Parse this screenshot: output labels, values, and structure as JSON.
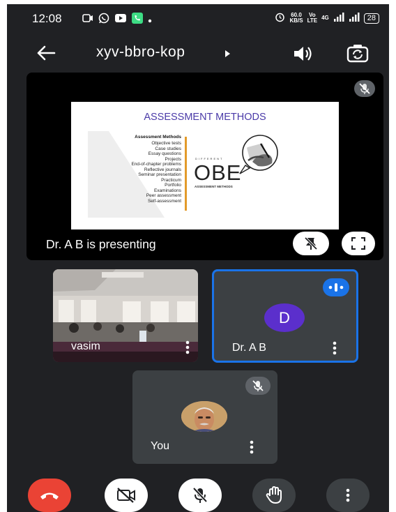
{
  "status_bar": {
    "time": "12:08",
    "net_speed_value": "60.0",
    "net_speed_unit": "KB/S",
    "volte_top": "Vo",
    "volte_bottom": "LTE",
    "network": "4G",
    "battery": "28",
    "icons": [
      "screen-record-icon",
      "whatsapp-icon",
      "youtube-icon",
      "phone-call-icon",
      "dot-icon",
      "alarm-icon",
      "signal-icon",
      "signal-icon"
    ]
  },
  "app_bar": {
    "meeting_code": "xyv-bbro-kop",
    "icons": [
      "back-arrow-icon",
      "chevron-right-icon",
      "speaker-icon",
      "switch-camera-icon"
    ]
  },
  "presentation": {
    "presenter_label": "Dr. A B is presenting",
    "slide": {
      "title": "ASSESSMENT METHODS",
      "list_heading": "Assessment Methods",
      "items": [
        "Objective tests",
        "Case studies",
        "Essay questions",
        "Projects",
        "End-of-chapter problems",
        "Reflective journals",
        "Seminar presentation",
        "Practicum",
        "Portfolio",
        "Examinations",
        "Peer assessment",
        "Self-assessment"
      ],
      "graphic_small": "DIFFERENT",
      "graphic_big": "OBE",
      "graphic_sub": "ASSESSMENT METHODS"
    },
    "icons": [
      "mic-off-icon",
      "unpin-icon",
      "fullscreen-icon"
    ]
  },
  "participants": [
    {
      "name": "vasim",
      "video": true
    },
    {
      "name": "Dr. A B",
      "avatar_letter": "D",
      "speaking": true
    },
    {
      "name": "You",
      "muted": true
    }
  ],
  "controls": {
    "icons": [
      "end-call-icon",
      "camera-off-icon",
      "mic-off-icon",
      "raise-hand-icon",
      "more-vert-icon"
    ]
  },
  "colors": {
    "background": "#202124",
    "tile": "#3c4043",
    "accent_blue": "#1a73e8",
    "end_call_red": "#ea4335",
    "avatar_purple": "#5b2fcc",
    "slide_title": "#4a3aa8"
  }
}
